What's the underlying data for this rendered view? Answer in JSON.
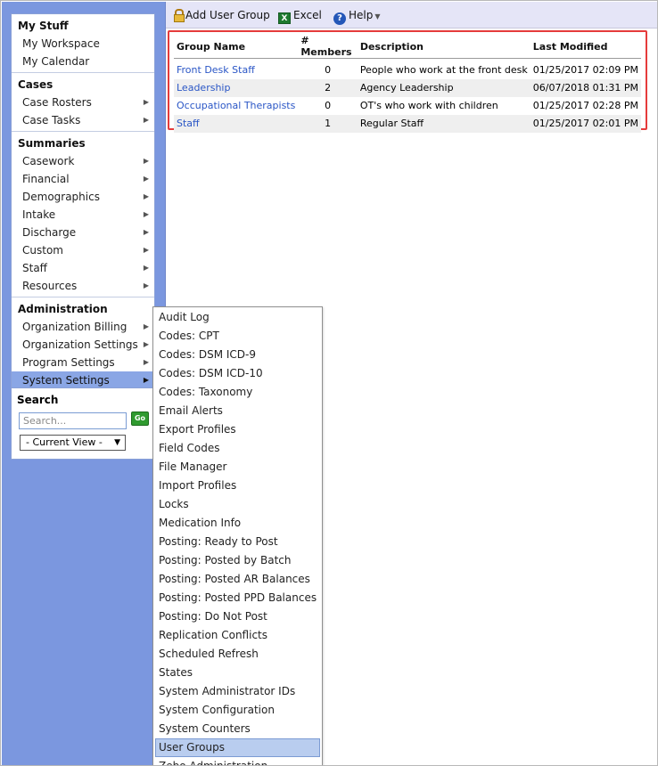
{
  "toolbar": {
    "add_user_group": "Add User Group",
    "excel": "Excel",
    "excel_icon_letter": "X",
    "help": "Help",
    "help_icon_letter": "?",
    "icons": [
      "lock-icon",
      "excel-icon",
      "help-icon",
      "chevron-down-icon"
    ]
  },
  "nav": {
    "my_stuff": {
      "header": "My Stuff",
      "items": [
        "My Workspace",
        "My Calendar"
      ]
    },
    "cases": {
      "header": "Cases",
      "items": [
        "Case Rosters",
        "Case Tasks"
      ]
    },
    "summaries": {
      "header": "Summaries",
      "items": [
        "Casework",
        "Financial",
        "Demographics",
        "Intake",
        "Discharge",
        "Custom",
        "Staff",
        "Resources"
      ]
    },
    "administration": {
      "header": "Administration",
      "items": [
        "Organization Billing",
        "Organization Settings",
        "Program Settings",
        "System Settings"
      ],
      "selected": "System Settings"
    }
  },
  "search": {
    "title": "Search",
    "placeholder": "Search...",
    "go_label": "Go",
    "view_value": "- Current View -"
  },
  "table": {
    "columns": [
      "Group Name",
      "# Members",
      "Description",
      "Last Modified"
    ],
    "rows": [
      {
        "name": "Front Desk Staff",
        "members": "0",
        "description": "People who work at the front desk",
        "modified": "01/25/2017 02:09 PM"
      },
      {
        "name": "Leadership",
        "members": "2",
        "description": "Agency Leadership",
        "modified": "06/07/2018 01:31 PM"
      },
      {
        "name": "Occupational Therapists",
        "members": "0",
        "description": "OT's who work with children",
        "modified": "01/25/2017 02:28 PM"
      },
      {
        "name": "Staff",
        "members": "1",
        "description": "Regular Staff",
        "modified": "01/25/2017 02:01 PM"
      }
    ],
    "highlight_color": "#e53b3b"
  },
  "submenu": {
    "items": [
      "Audit Log",
      "Codes: CPT",
      "Codes: DSM ICD-9",
      "Codes: DSM ICD-10",
      "Codes: Taxonomy",
      "Email Alerts",
      "Export Profiles",
      "Field Codes",
      "File Manager",
      "Import Profiles",
      "Locks",
      "Medication Info",
      "Posting: Ready to Post",
      "Posting: Posted by Batch",
      "Posting: Posted AR Balances",
      "Posting: Posted PPD Balances",
      "Posting: Do Not Post",
      "Replication Conflicts",
      "Scheduled Refresh",
      "States",
      "System Administrator IDs",
      "System Configuration",
      "System Counters",
      "User Groups",
      "Zebo Administration"
    ],
    "active": "User Groups"
  },
  "colors": {
    "sidebar_bg": "#7b97df",
    "toolbar_bg": "#e5e5f7",
    "link": "#2a56c6",
    "selected_nav": "#8aa6e5",
    "active_submenu": "#b9cdef"
  }
}
